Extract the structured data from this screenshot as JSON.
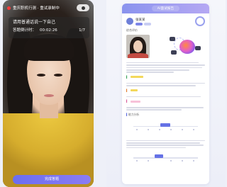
{
  "phone": {
    "top_text": "重庆职机行测 · 重试录制中",
    "prompt": "请用普通话说一下自己",
    "timer_label": "答题倒计时：",
    "timer_value": "00:02:26",
    "page_indicator": "1/7",
    "bottom_button": "完成答题"
  },
  "report": {
    "header_title": "AI面试报告",
    "candidate_name": "张某某",
    "section_basic": "综合评价",
    "section_detail": "能力分析"
  },
  "colors": {
    "accent": "#6b6ef0",
    "recording": "#ff3b3b",
    "shirt": "#e7c43d"
  }
}
